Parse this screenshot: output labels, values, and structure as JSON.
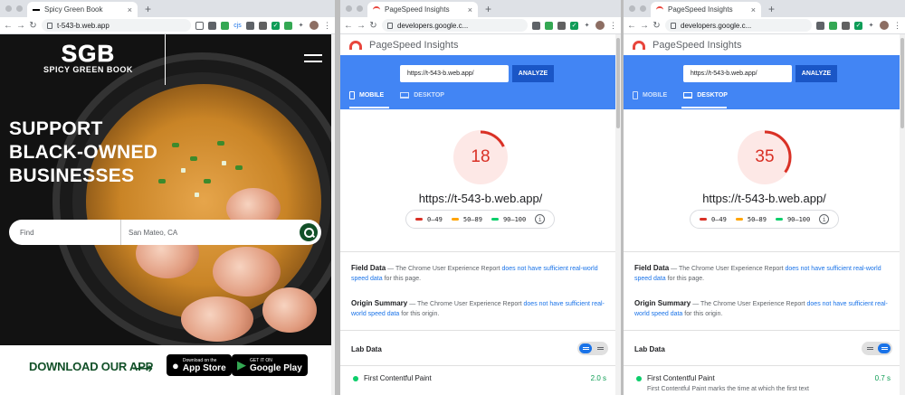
{
  "window_left": {
    "tab_title": "Spicy Green Book",
    "url": "t-543-b.web.app",
    "logo_big": "SGB",
    "logo_small": "SPICY GREEN BOOK",
    "headline": [
      "SUPPORT",
      "BLACK-OWNED",
      "BUSINESSES"
    ],
    "search_find_placeholder": "Find",
    "search_location": "San Mateo, CA",
    "download_label": "DOWNLOAD OUR APP",
    "app_store_small": "Download on the",
    "app_store_big": "App Store",
    "play_small": "GET IT ON",
    "play_big": "Google Play"
  },
  "psi_shared": {
    "tab_title": "PageSpeed Insights",
    "url": "developers.google.c...",
    "header_title": "PageSpeed Insights",
    "input_value": "https://t-543-b.web.app/",
    "analyze": "ANALYZE",
    "mobile": "MOBILE",
    "desktop": "DESKTOP",
    "site_url": "https://t-543-b.web.app/",
    "legend": [
      "0–49",
      "50–89",
      "90–100"
    ],
    "field_title": "Field Data",
    "field_pre": " — The Chrome User Experience Report ",
    "field_link": "does not have sufficient real-world speed data",
    "field_post": " for this page.",
    "origin_title": "Origin Summary",
    "origin_pre": " — The Chrome User Experience Report ",
    "origin_link": "does not have sufficient real-world speed data",
    "origin_post": " for this origin.",
    "lab_title": "Lab Data",
    "metric_name": "First Contentful Paint"
  },
  "window_mid": {
    "score": "18",
    "score_fraction": 0.18,
    "active_tab": "mobile",
    "metric_value": "2.0 s"
  },
  "window_right": {
    "score": "35",
    "score_fraction": 0.35,
    "active_tab": "desktop",
    "metric_value": "0.7 s",
    "metric_desc": "First Contentful Paint marks the time at which the first text"
  },
  "colors": {
    "brand_green": "#125028",
    "psi_blue": "#4285f4",
    "fail_red": "#d93025",
    "average_orange": "#ffa400",
    "pass_green": "#0cce6b"
  }
}
